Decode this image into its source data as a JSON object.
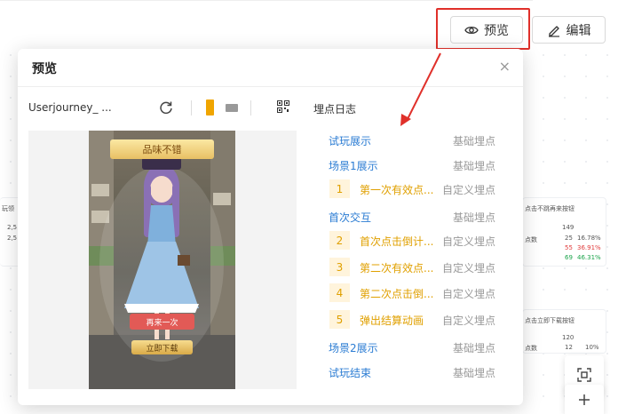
{
  "header": {
    "preview_label": "预览",
    "edit_label": "编辑"
  },
  "background": {
    "card_left": {
      "title": "玩领",
      "row1": "2,5",
      "row2": "2,5"
    },
    "card_right_1": {
      "title": "点击不跳再来按钮",
      "count": "149",
      "label": "点数",
      "rows": [
        {
          "value": "25",
          "percent": "16.78%",
          "color": "#333333"
        },
        {
          "value": "55",
          "percent": "36.91%",
          "color": "#e03c3c"
        },
        {
          "value": "69",
          "percent": "46.31%",
          "color": "#1aa34a"
        }
      ]
    },
    "card_right_2": {
      "title": "点击立即下载按钮",
      "count": "120",
      "label": "点数",
      "row": {
        "value": "12",
        "percent": "10%"
      }
    }
  },
  "modal": {
    "title": "预览",
    "close": "×",
    "project_name": "Userjourney_ ...",
    "log_title": "埋点日志",
    "game": {
      "banner": "品味不错",
      "again_button": "再来一次",
      "download_button": "立即下载"
    },
    "log_items": [
      {
        "kind": "base",
        "name": "试玩展示",
        "type": "基础埋点"
      },
      {
        "kind": "base",
        "name": "场景1展示",
        "type": "基础埋点"
      },
      {
        "kind": "custom",
        "num": "1",
        "name": "第一次有效点...",
        "type": "自定义埋点"
      },
      {
        "kind": "base",
        "name": "首次交互",
        "type": "基础埋点"
      },
      {
        "kind": "custom",
        "num": "2",
        "name": "首次点击倒计...",
        "type": "自定义埋点"
      },
      {
        "kind": "custom",
        "num": "3",
        "name": "第二次有效点...",
        "type": "自定义埋点"
      },
      {
        "kind": "custom",
        "num": "4",
        "name": "第二次点击倒...",
        "type": "自定义埋点"
      },
      {
        "kind": "custom",
        "num": "5",
        "name": "弹出结算动画",
        "type": "自定义埋点"
      },
      {
        "kind": "base",
        "name": "场景2展示",
        "type": "基础埋点"
      },
      {
        "kind": "base",
        "name": "试玩结束",
        "type": "基础埋点"
      }
    ]
  },
  "tools": {
    "fit_icon": "fit-screen-icon",
    "add_icon": "plus-icon"
  },
  "colors": {
    "accent_red": "#e0302a",
    "link_blue": "#2b7cd3",
    "custom_orange": "#e0a000",
    "portrait_active": "#f0a500"
  }
}
